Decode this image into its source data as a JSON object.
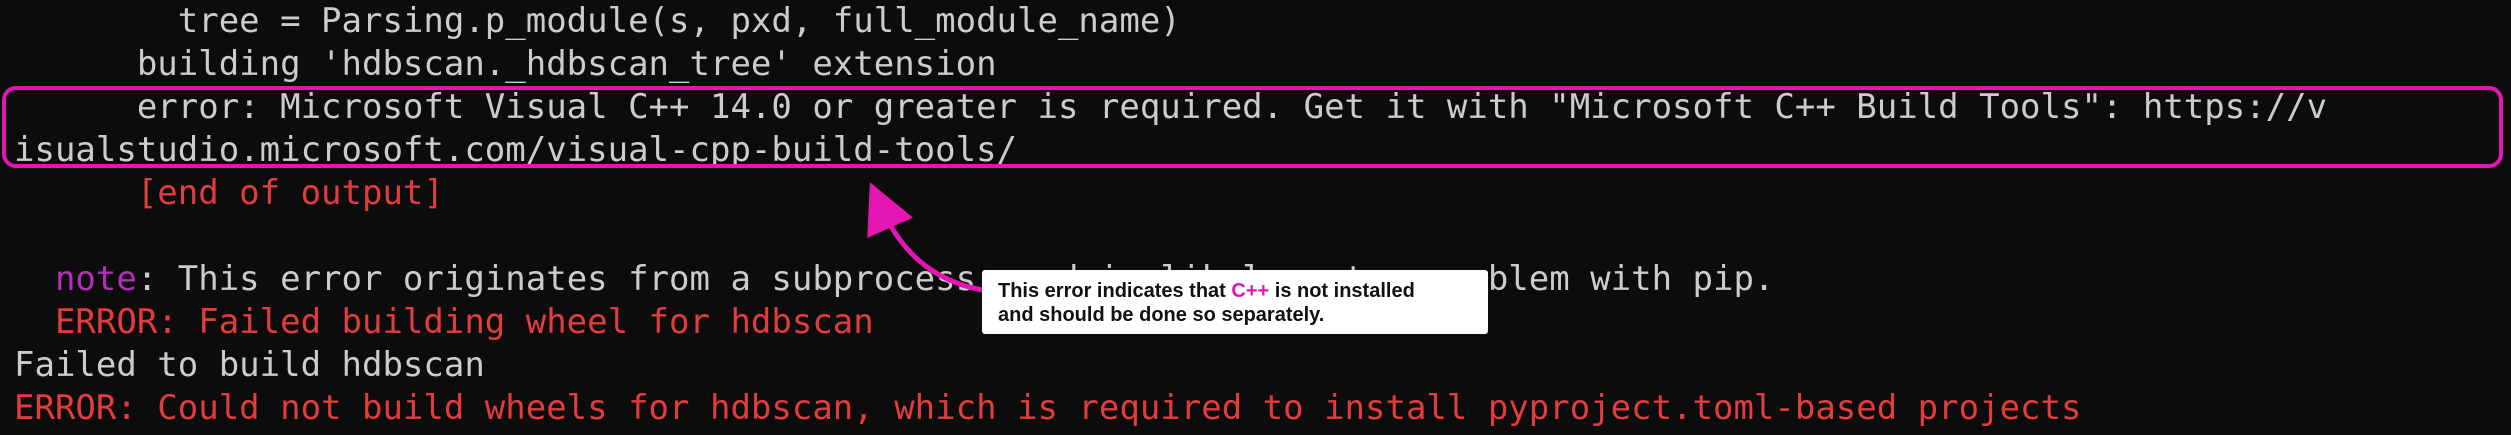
{
  "terminal": {
    "lines": [
      {
        "text": "        tree = Parsing.p_module(s, pxd, full_module_name)",
        "color": "#cccccc"
      },
      {
        "text": "      building 'hdbscan._hdbscan_tree' extension",
        "color": "#cccccc"
      },
      {
        "text": "      error: Microsoft Visual C++ 14.0 or greater is required. Get it with \"Microsoft C++ Build Tools\": https://v",
        "color": "#cccccc"
      },
      {
        "text": "isualstudio.microsoft.com/visual-cpp-build-tools/",
        "color": "#cccccc"
      },
      {
        "text": "      [end of output]",
        "color": "#e23c3c"
      },
      {
        "text": "",
        "color": "#cccccc"
      },
      {
        "prefix": "  note",
        "text": ": This error originates from a subprocess, and is likely not a problem with pip.",
        "color": "#cccccc"
      },
      {
        "text": "  ERROR: Failed building wheel for hdbscan",
        "color": "#e23c3c"
      },
      {
        "text": "Failed to build hdbscan",
        "color": "#cccccc"
      },
      {
        "text": "ERROR: Could not build wheels for hdbscan, which is required to install pyproject.toml-based projects",
        "color": "#e23c3c"
      }
    ]
  },
  "annotation": {
    "part1": "This error indicates that ",
    "accent": "C++",
    "part2": " is not installed",
    "line2": "and should be done so separately.",
    "highlight_color": "#e316b4"
  }
}
